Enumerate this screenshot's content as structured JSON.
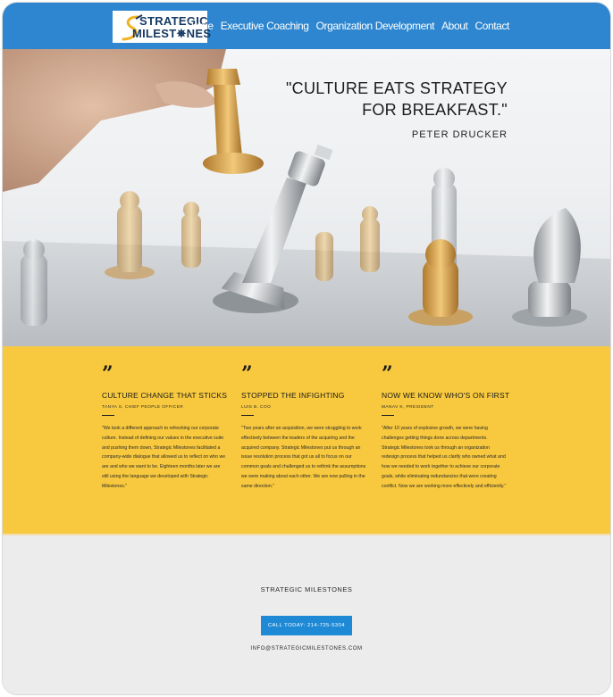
{
  "brand": {
    "line1": "STRATEGIC",
    "line2": "MILEST✵NES",
    "colors": {
      "header": "#2d86cf",
      "accent": "#f8c93e",
      "button": "#1e8ad6"
    }
  },
  "nav": {
    "items": [
      "Home",
      "Executive Coaching",
      "Organization Development",
      "About",
      "Contact"
    ]
  },
  "hero": {
    "quote_line1": "\"CULTURE EATS STRATEGY",
    "quote_line2": "FOR BREAKFAST.\"",
    "attribution": "PETER DRUCKER"
  },
  "testimonials": [
    {
      "mark": "”",
      "title": "CULTURE CHANGE THAT STICKS",
      "author": "TANYA S, CHIEF PEOPLE OFFICER",
      "body": "\"We took a different approach to refreshing our corporate culture. Instead of defining our values in the executive suite and pushing them down, Strategic Milestones facilitated a company-wide dialogue that allowed us to reflect on who we are and who we want to be. Eighteen months later we are still using the language we developed with Strategic Milestones.\""
    },
    {
      "mark": "”",
      "title": "STOPPED THE INFIGHTING",
      "author": "LUIS B. COO",
      "body": "\"Two years after an acquisition, we were struggling to work effectively between the leaders of the acquiring and the acquired company. Strategic Milestones put us through an issue resolution process that got us all to focus on our common goals and challenged us to rethink the assumptions we were making about each other. We are now pulling in the same direction.\""
    },
    {
      "mark": "”",
      "title": "NOW WE KNOW WHO'S ON FIRST",
      "author": "MANAV K, PRESIDENT",
      "body": "\"After 10 years of explosive growth, we were having challenges getting things done across departments. Strategic Milestones took us through an organization redesign process that helped us clarify who owned what and how we needed to work together to achieve our corporate goals, while eliminating redundancies that were creating conflict. Now we are working more effectively and efficiently.\""
    }
  ],
  "footer": {
    "company": "STRATEGIC MILESTONES",
    "cta": "CALL TODAY: 214-725-5304",
    "email": "INFO@STRATEGICMILESTONES.COM"
  }
}
